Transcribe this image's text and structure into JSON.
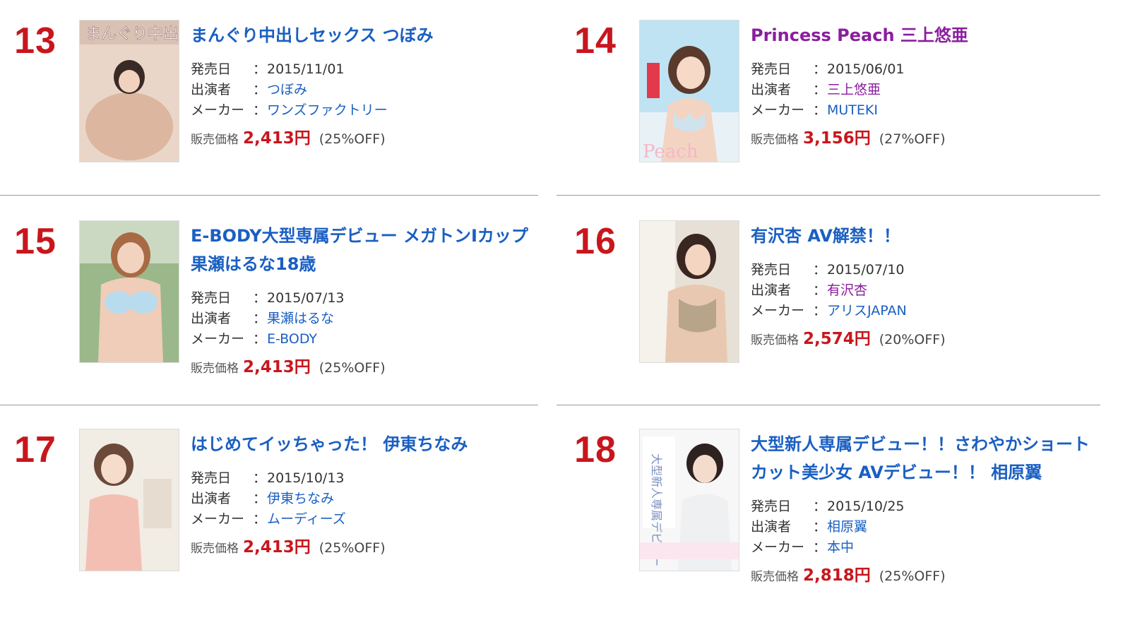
{
  "labels": {
    "release": "発売日",
    "cast": "出演者",
    "maker": "メーカー",
    "sep": "：",
    "price": "販売価格"
  },
  "items": [
    {
      "rank": "13",
      "title": "まんぐり中出しセックス つぼみ",
      "release_date": "2015/11/01",
      "cast": "つぼみ",
      "maker": "ワンズファクトリー",
      "price": "2,413円",
      "discount": "(25%OFF)",
      "cover_text": "まんぐり中出しセックス"
    },
    {
      "rank": "14",
      "title": "Princess Peach 三上悠亜",
      "release_date": "2015/06/01",
      "cast": "三上悠亜",
      "maker": "MUTEKI",
      "price": "3,156円",
      "discount": "(27%OFF)",
      "cover_text": "Peach"
    },
    {
      "rank": "15",
      "title": "E-BODY大型専属デビュー メガトンIカップ 果瀬はるな18歳",
      "release_date": "2015/07/13",
      "cast": "果瀬はるな",
      "maker": "E-BODY",
      "price": "2,413円",
      "discount": "(25%OFF)",
      "cover_text": ""
    },
    {
      "rank": "16",
      "title": "有沢杏 AV解禁！！",
      "release_date": "2015/07/10",
      "cast": "有沢杏",
      "maker": "アリスJAPAN",
      "price": "2,574円",
      "discount": "(20%OFF)",
      "cover_text": ""
    },
    {
      "rank": "17",
      "title": "はじめてイッちゃった！ 伊東ちなみ",
      "release_date": "2015/10/13",
      "cast": "伊東ちなみ",
      "maker": "ムーディーズ",
      "price": "2,413円",
      "discount": "(25%OFF)",
      "cover_text": ""
    },
    {
      "rank": "18",
      "title": "大型新人専属デビュー！！さわやかショートカット美少女 AVデビュー！！ 相原翼",
      "release_date": "2015/10/25",
      "cast": "相原翼",
      "maker": "本中",
      "price": "2,818円",
      "discount": "(25%OFF)",
      "cover_text": "大型新人専属デビュー"
    }
  ],
  "colors": {
    "rank": "#c8161d",
    "title_blue": "#1a5fc2",
    "title_purple": "#8a1d9e",
    "price": "#c8161d"
  }
}
